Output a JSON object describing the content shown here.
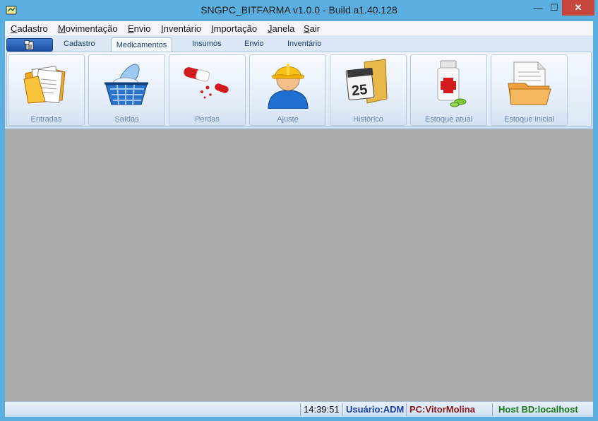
{
  "window": {
    "title": "SNGPC_BITFARMA v1.0.0 - Build a1.40.128",
    "min_label": "—",
    "max_label": "☐",
    "close_label": "✕"
  },
  "menu": [
    {
      "label": "Cadastro",
      "underline": "C",
      "rest": "adastro"
    },
    {
      "label": "Movimentação",
      "underline": "M",
      "rest": "ovimentação"
    },
    {
      "label": "Envio",
      "underline": "E",
      "rest": "nvio"
    },
    {
      "label": "Inventário",
      "underline": "I",
      "rest": "nventário"
    },
    {
      "label": "Importação",
      "underline": "I",
      "rest": "mportação"
    },
    {
      "label": "Janela",
      "underline": "J",
      "rest": "anela"
    },
    {
      "label": "Sair",
      "underline": "S",
      "rest": "air"
    }
  ],
  "tabs": [
    "Cadastro",
    "Medicamentos",
    "Insumos",
    "Envio",
    "Inventário"
  ],
  "tools": [
    {
      "label": "Entradas",
      "icon": "documents-icon"
    },
    {
      "label": "Saídas",
      "icon": "basket-icon"
    },
    {
      "label": "Perdas",
      "icon": "pills-icon"
    },
    {
      "label": "Ajuste",
      "icon": "worker-icon"
    },
    {
      "label": "Histórico",
      "icon": "calendar-folder-icon",
      "day": "25"
    },
    {
      "label": "Estoque atual",
      "icon": "medicine-bottle-icon"
    },
    {
      "label": "Estoque inicial",
      "icon": "document-folder-icon"
    }
  ],
  "status": {
    "time": "14:39:51",
    "user": "Usuário:ADM",
    "pc": "PC:VitorMolina",
    "host": "Host BD:localhost",
    "user_color": "#1a3fa8",
    "pc_color": "#8b1a1a",
    "host_color": "#1a7a1a"
  }
}
